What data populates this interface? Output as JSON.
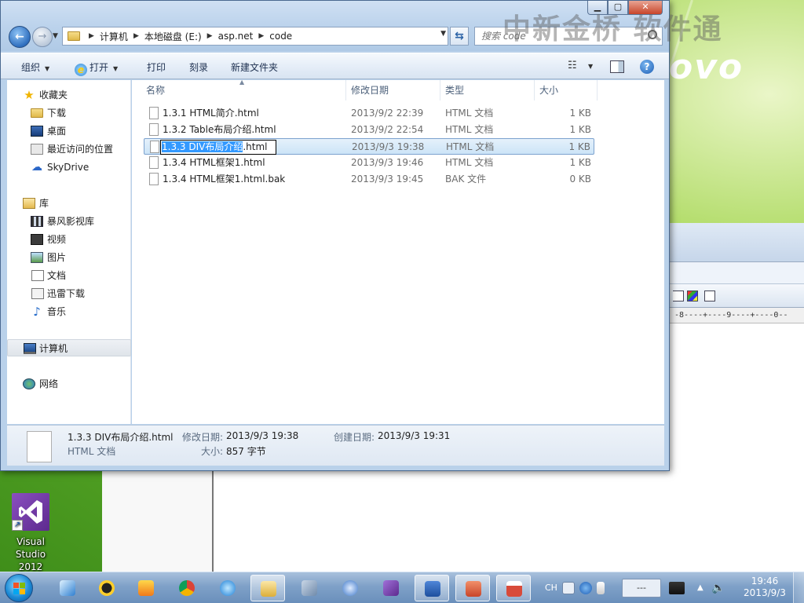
{
  "watermark": "中新金桥  软件通",
  "wallpaper_brand": "ovo",
  "explorer": {
    "breadcrumb": [
      "计算机",
      "本地磁盘 (E:)",
      "asp.net",
      "code"
    ],
    "search_placeholder": "搜索 code",
    "toolbar": {
      "organize": "组织",
      "open": "打开",
      "print": "打印",
      "burn": "刻录",
      "new_folder": "新建文件夹"
    },
    "nav": {
      "favorites": "收藏夹",
      "downloads": "下载",
      "desktop": "桌面",
      "recent": "最近访问的位置",
      "skydrive": "SkyDrive",
      "libraries": "库",
      "storm_video": "暴风影视库",
      "videos": "视频",
      "pictures": "图片",
      "documents": "文档",
      "thunder": "迅雷下载",
      "music": "音乐",
      "computer": "计算机",
      "network": "网络"
    },
    "columns": {
      "name": "名称",
      "date": "修改日期",
      "type": "类型",
      "size": "大小"
    },
    "files": [
      {
        "name": "1.3.1 HTML简介.html",
        "date": "2013/9/2 22:39",
        "type": "HTML 文档",
        "size": "1 KB"
      },
      {
        "name": "1.3.2 Table布局介绍.html",
        "date": "2013/9/2 22:54",
        "type": "HTML 文档",
        "size": "1 KB"
      },
      {
        "name": "1.3.3 DIV布局介绍.html",
        "date": "2013/9/3 19:38",
        "type": "HTML 文档",
        "size": "1 KB"
      },
      {
        "name": "1.3.4 HTML框架1.html",
        "date": "2013/9/3 19:46",
        "type": "HTML 文档",
        "size": "1 KB"
      },
      {
        "name": "1.3.4 HTML框架1.html.bak",
        "date": "2013/9/3 19:45",
        "type": "BAK 文件",
        "size": "0 KB"
      }
    ],
    "rename": {
      "selected_part": "1.3.3 DIV布局介绍",
      "extension_part": ".html"
    },
    "details": {
      "filename": "1.3.3 DIV布局介绍.html",
      "filetype": "HTML 文档",
      "modified_label": "修改日期:",
      "modified_value": "2013/9/3 19:38",
      "created_label": "创建日期:",
      "created_value": "2013/9/3 19:31",
      "size_label": "大小:",
      "size_value": "857 字节"
    }
  },
  "background_app": {
    "ruler": "-8----+----9----+----0--"
  },
  "desktop_icons": {
    "vs_label_line1": "Visual",
    "vs_label_line2": "Studio 2012"
  },
  "taskbar": {
    "lang": "CH",
    "ime": "---",
    "time": "19:46",
    "date": "2013/9/3"
  },
  "colors": {
    "selection": "#cce4f7",
    "rename_highlight": "#3399ff",
    "taskbar": "#7fa1c8"
  }
}
